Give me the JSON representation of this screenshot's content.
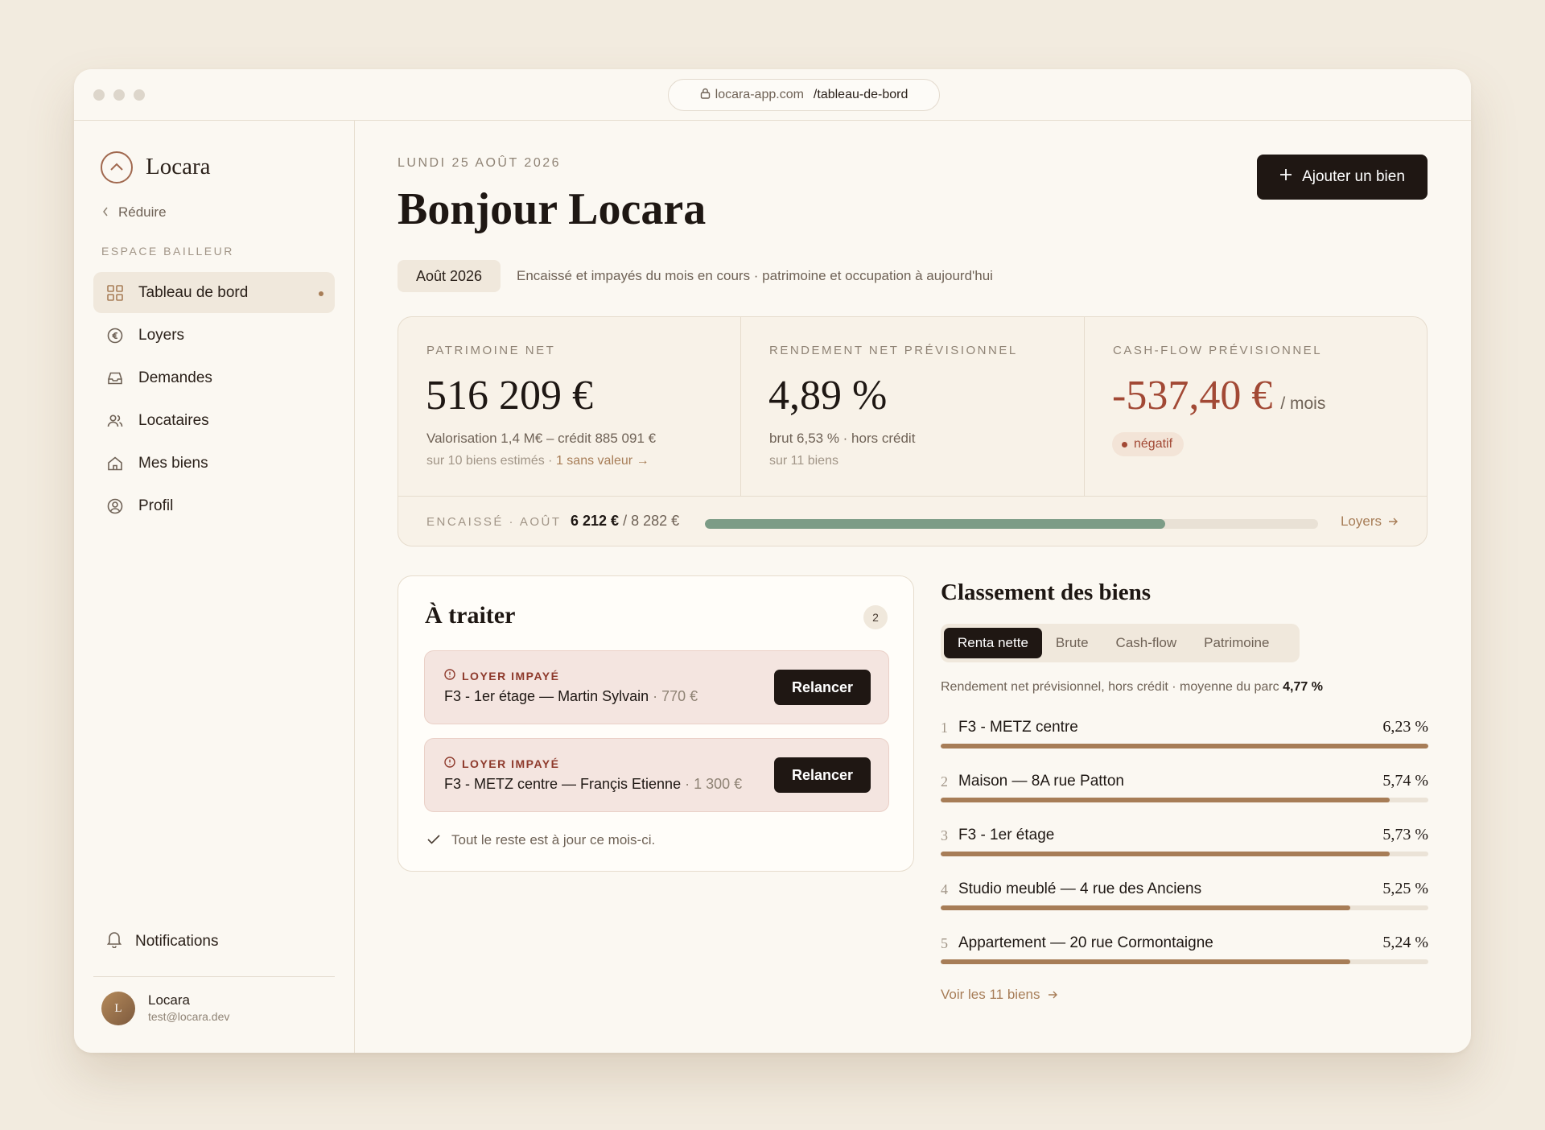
{
  "browser": {
    "url_host": "locara-app.com",
    "url_path": "/tableau-de-bord"
  },
  "sidebar": {
    "brand": "Locara",
    "collapse_label": "Réduire",
    "section_label": "ESPACE BAILLEUR",
    "items": [
      {
        "label": "Tableau de bord",
        "icon": "grid-icon",
        "active": true
      },
      {
        "label": "Loyers",
        "icon": "euro-circle-icon"
      },
      {
        "label": "Demandes",
        "icon": "inbox-icon"
      },
      {
        "label": "Locataires",
        "icon": "users-icon"
      },
      {
        "label": "Mes biens",
        "icon": "home-icon"
      },
      {
        "label": "Profil",
        "icon": "user-circle-icon"
      }
    ],
    "notifications_label": "Notifications",
    "user": {
      "initial": "L",
      "name": "Locara",
      "email": "test@locara.dev"
    }
  },
  "header": {
    "date": "LUNDI 25 AOÛT 2026",
    "greeting": "Bonjour Locara",
    "add_button": "Ajouter un bien",
    "month": "Août 2026",
    "month_description": "Encaissé et impayés du mois en cours · patrimoine et occupation à aujourd'hui"
  },
  "stats": {
    "patrimoine": {
      "label": "PATRIMOINE NET",
      "value": "516 209 €",
      "sub1": "Valorisation 1,4 M€ – crédit 885 091 €",
      "sub2": "sur 10 biens estimés · ",
      "sub2_link": "1 sans valeur →"
    },
    "rendement": {
      "label": "RENDEMENT NET PRÉVISIONNEL",
      "value": "4,89 %",
      "sub1": "brut 6,53 % · hors crédit",
      "sub2": "sur 11 biens"
    },
    "cashflow": {
      "label": "CASH-FLOW PRÉVISIONNEL",
      "value": "-537,40 €",
      "unit": "/ mois",
      "badge": "négatif"
    },
    "encaisse": {
      "label": "ENCAISSÉ · AOÛT",
      "collected": "6 212 €",
      "expected": "/ 8 282 €",
      "progress": 0.75,
      "link": "Loyers"
    }
  },
  "todo": {
    "title": "À traiter",
    "count": "2",
    "alerts": [
      {
        "type": "LOYER IMPAYÉ",
        "text": "F3 - 1er étage — Martin Sylvain",
        "amount": " · 770 €",
        "action": "Relancer"
      },
      {
        "type": "LOYER IMPAYÉ",
        "text": "F3 - METZ centre — Françis Etienne",
        "amount": " · 1 300 €",
        "action": "Relancer"
      }
    ],
    "ok_message": "Tout le reste est à jour ce mois-ci."
  },
  "ranking": {
    "title": "Classement des biens",
    "tabs": [
      "Renta nette",
      "Brute",
      "Cash-flow",
      "Patrimoine"
    ],
    "active_tab": "Renta nette",
    "description": "Rendement net prévisionnel, hors crédit · moyenne du parc ",
    "average": "4,77 %",
    "items": [
      {
        "rank": "1",
        "name": "F3 - METZ centre",
        "pct": "6,23 %",
        "fill": 1.0
      },
      {
        "rank": "2",
        "name": "Maison — 8A rue Patton",
        "pct": "5,74 %",
        "fill": 0.92
      },
      {
        "rank": "3",
        "name": "F3 - 1er étage",
        "pct": "5,73 %",
        "fill": 0.92
      },
      {
        "rank": "4",
        "name": "Studio meublé — 4 rue des Anciens",
        "pct": "5,25 %",
        "fill": 0.84
      },
      {
        "rank": "5",
        "name": "Appartement — 20 rue Cormontaigne",
        "pct": "5,24 %",
        "fill": 0.84
      }
    ],
    "more_link": "Voir les 11 biens"
  },
  "colors": {
    "accent": "#a77d57",
    "negative": "#a24935",
    "progress": "#7c9c86",
    "dark": "#1f1713"
  }
}
